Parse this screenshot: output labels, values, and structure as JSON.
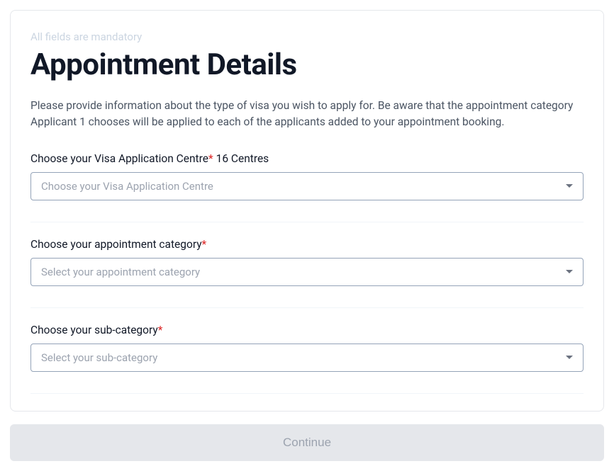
{
  "header": {
    "mandatory_note": "All fields are mandatory",
    "title": "Appointment Details",
    "description": "Please provide information about the type of visa you wish to apply for. Be aware that the appointment category Applicant 1 chooses will be applied to each of the applicants added to your appointment booking."
  },
  "fields": {
    "vac": {
      "label": "Choose your Visa Application Centre",
      "required_mark": "*",
      "suffix": "16 Centres",
      "placeholder": "Choose your Visa Application Centre"
    },
    "category": {
      "label": "Choose your appointment category",
      "required_mark": "*",
      "placeholder": "Select your appointment category"
    },
    "subcategory": {
      "label": "Choose your sub-category",
      "required_mark": "*",
      "placeholder": "Select your sub-category"
    }
  },
  "actions": {
    "continue_label": "Continue"
  }
}
